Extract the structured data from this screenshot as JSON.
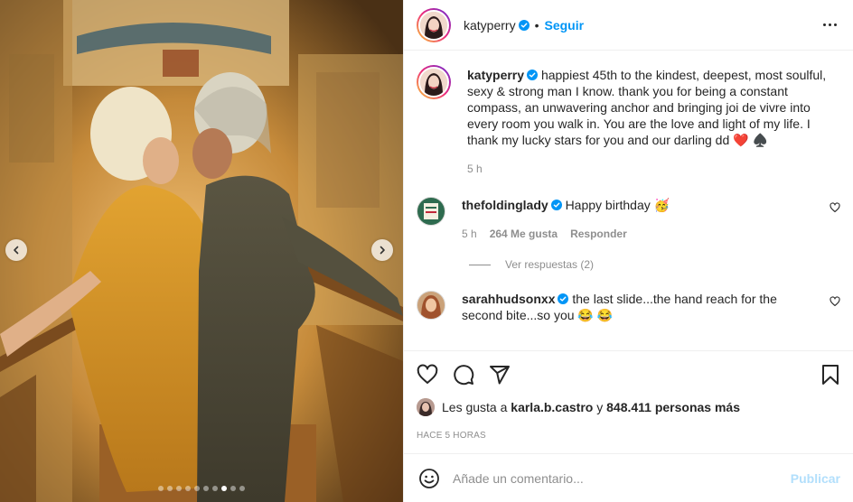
{
  "post": {
    "author": "katyperry",
    "follow_label": "Seguir",
    "separator": "•",
    "caption": "happiest 45th to the kindest, deepest, most soulful, sexy & strong man I know. thank you for being a constant compass, an unwavering anchor and bringing joi de vivre into every room you walk in. You are the love and light of my life. I thank my lucky stars for you and our darling dd ❤️ ♠️",
    "caption_time": "5 h"
  },
  "comments": [
    {
      "username": "thefoldinglady",
      "text": "Happy birthday 🥳",
      "time": "5 h",
      "likes": "264 Me gusta",
      "reply_label": "Responder",
      "view_replies": "Ver respuestas (2)"
    },
    {
      "username": "sarahhudsonxx",
      "text": "the last slide...the hand reach for the second bite...so you 😂 😂"
    }
  ],
  "likes": {
    "prefix": "Les gusta a",
    "user": "karla.b.castro",
    "middle": "y",
    "others": "848.411 personas más"
  },
  "timestamp": "HACE 5 HORAS",
  "add_comment": {
    "placeholder": "Añade un comentario...",
    "publish_label": "Publicar"
  },
  "carousel": {
    "total_slides": 10,
    "active_index": 7
  },
  "icons": {
    "like": "heart-icon",
    "comment": "comment-bubble-icon",
    "share": "paper-plane-icon",
    "save": "bookmark-icon",
    "emoji": "smiley-icon",
    "more": "more-options-icon",
    "verified": "verified-badge-icon"
  },
  "colors": {
    "accent": "#0095f6",
    "publish_disabled": "#b2dffc",
    "secondary_text": "#8e8e8e",
    "verified": "#0095f6"
  }
}
